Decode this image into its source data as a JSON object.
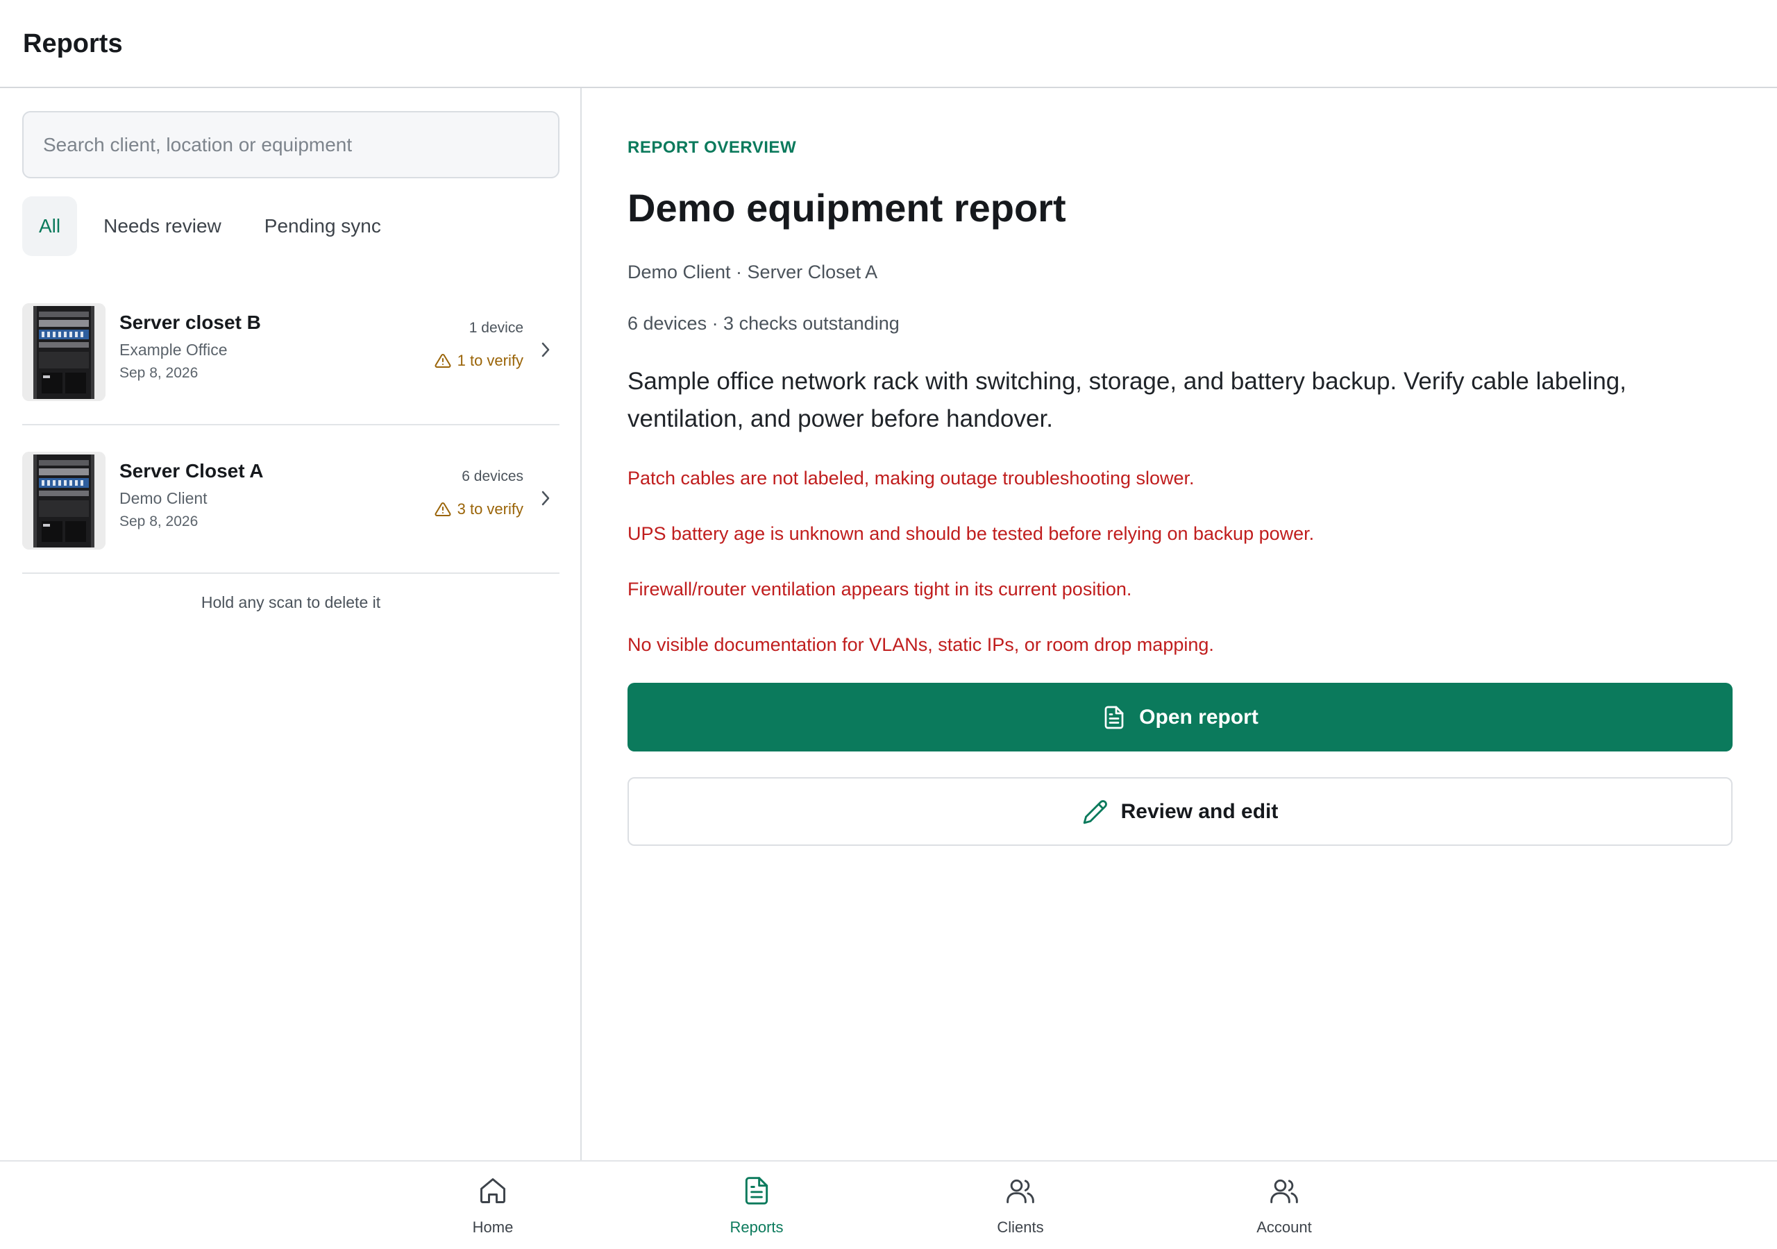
{
  "header": {
    "title": "Reports"
  },
  "search": {
    "placeholder": "Search client, location or equipment",
    "value": ""
  },
  "filters": [
    {
      "label": "All",
      "active": true
    },
    {
      "label": "Needs review",
      "active": false
    },
    {
      "label": "Pending sync",
      "active": false
    }
  ],
  "reports": [
    {
      "title": "Server closet B",
      "client": "Example Office",
      "date": "Sep 8, 2026",
      "devices": "1 device",
      "verify": "1 to verify"
    },
    {
      "title": "Server Closet A",
      "client": "Demo Client",
      "date": "Sep 8, 2026",
      "devices": "6 devices",
      "verify": "3 to verify"
    }
  ],
  "hint": "Hold any scan to delete it",
  "detail": {
    "overline": "REPORT OVERVIEW",
    "title": "Demo equipment report",
    "meta_location": "Demo Client · Server Closet A",
    "meta_counts": "6 devices · 3 checks outstanding",
    "description": "Sample office network rack with switching, storage, and battery backup. Verify cable labeling, ventilation, and power before handover.",
    "issues": [
      "Patch cables are not labeled, making outage troubleshooting slower.",
      "UPS battery age is unknown and should be tested before relying on backup power.",
      "Firewall/router ventilation appears tight in its current position.",
      "No visible documentation for VLANs, static IPs, or room drop mapping."
    ],
    "primary_button": "Open report",
    "secondary_button": "Review and edit"
  },
  "nav": [
    {
      "label": "Home",
      "icon": "home-icon",
      "active": false
    },
    {
      "label": "Reports",
      "icon": "document-icon",
      "active": true
    },
    {
      "label": "Clients",
      "icon": "users-icon",
      "active": false
    },
    {
      "label": "Account",
      "icon": "account-icon",
      "active": false
    }
  ],
  "colors": {
    "accent": "#0b7a5c",
    "warning": "#9a6408",
    "danger": "#c01d1d"
  }
}
